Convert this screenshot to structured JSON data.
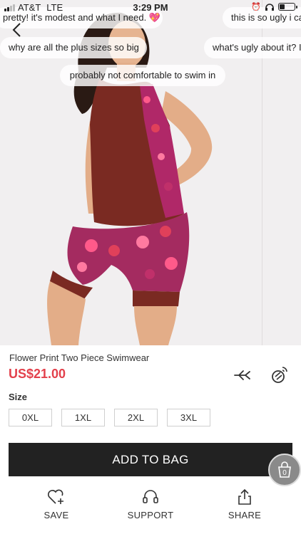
{
  "status_bar": {
    "carrier": "AT&T",
    "network": "LTE",
    "time": "3:29 PM",
    "battery_level": 0.3
  },
  "comments": [
    "pretty! it's modest and what I need.",
    "this is so ugly i ca",
    "why are all the plus sizes so big",
    "what's ugly about it? I",
    "probably not comfortable to swim in"
  ],
  "comment_emoji": "💖",
  "product": {
    "title": "Flower Print Two Piece Swimwear",
    "price": "US$21.00",
    "size_label": "Size",
    "sizes": [
      "0XL",
      "1XL",
      "2XL",
      "3XL"
    ]
  },
  "add_to_bag_label": "ADD TO BAG",
  "cart_count": "0",
  "actions": {
    "save": "SAVE",
    "support": "SUPPORT",
    "share": "SHARE"
  },
  "colors": {
    "price": "#e3404b",
    "button": "#222222",
    "top": "#7a2a22"
  },
  "icons": [
    "back-arrow-icon",
    "cast-icon",
    "satellite-icon",
    "cart-icon",
    "heart-plus-icon",
    "headset-icon",
    "share-icon"
  ]
}
